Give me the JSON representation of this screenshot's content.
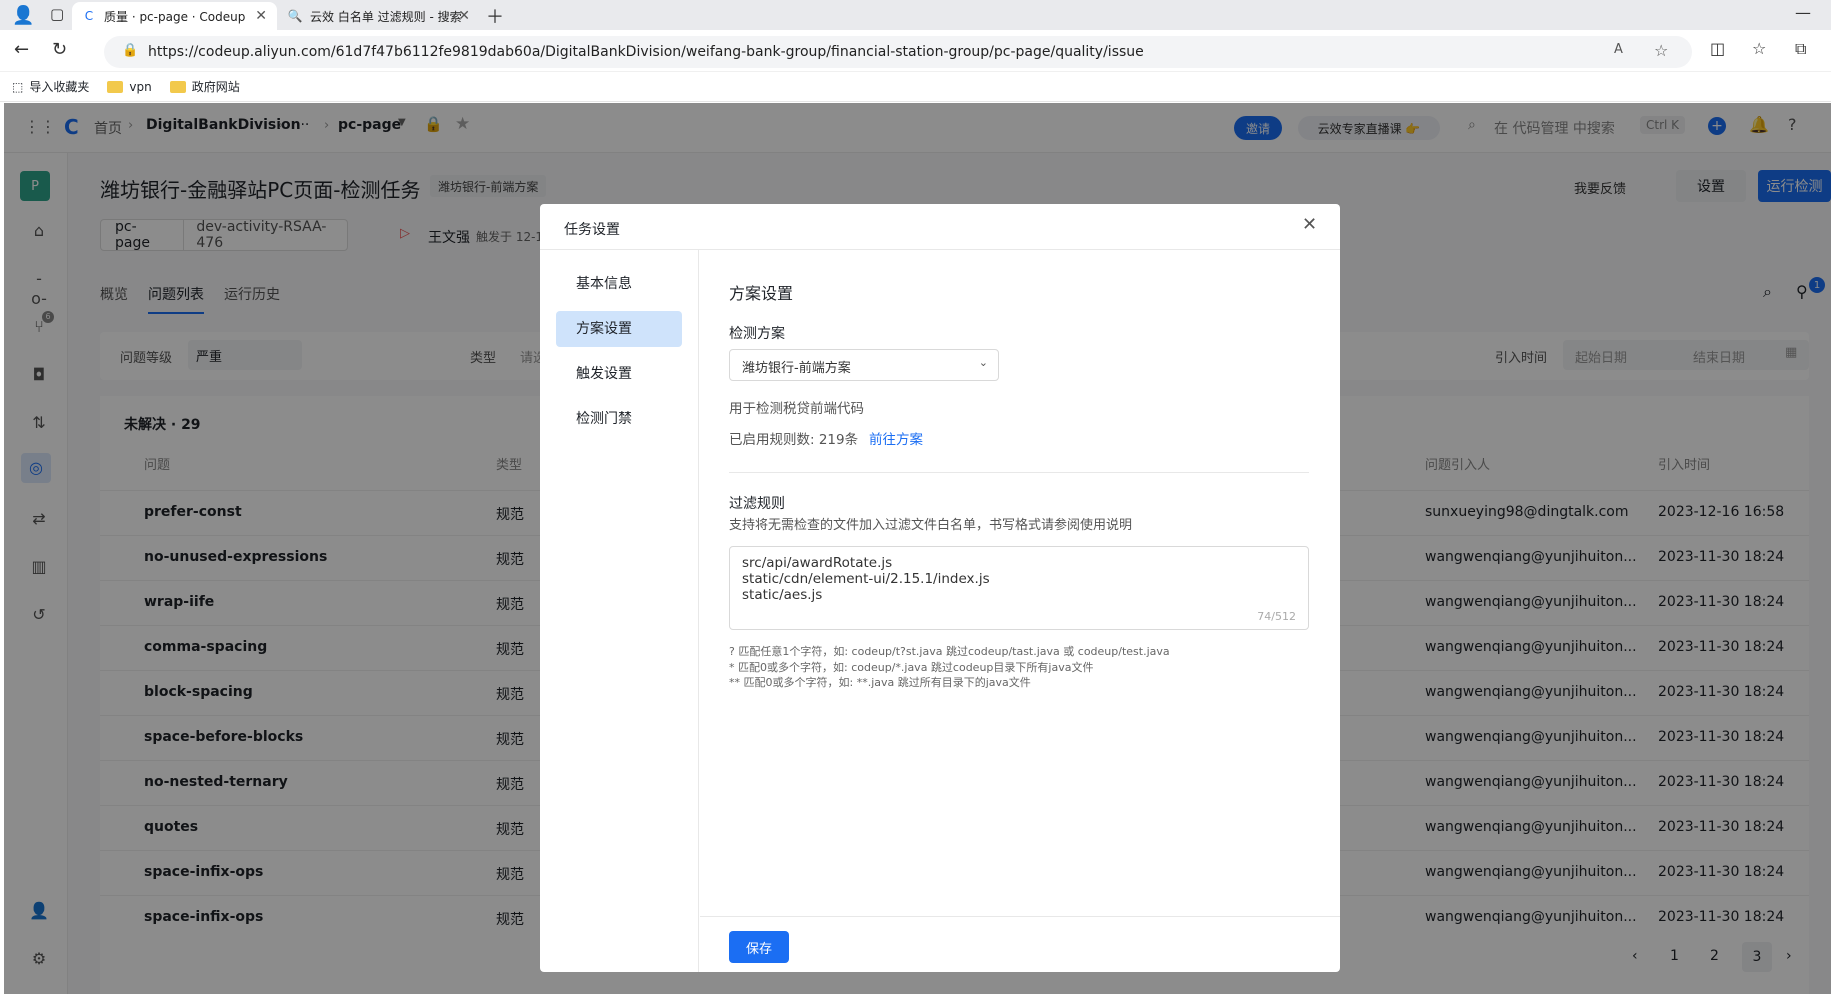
{
  "browser": {
    "tabs": [
      {
        "title": "质量 · pc-page · Codeup",
        "active": true
      },
      {
        "title": "云效 白名单 过滤规则 - 搜索",
        "active": false
      }
    ],
    "url": "https://codeup.aliyun.com/61d7f47b6112fe9819dab60a/DigitalBankDivision/weifang-bank-group/financial-station-group/pc-page/quality/issue",
    "bookmarks": [
      "导入收藏夹",
      "vpn",
      "政府网站"
    ]
  },
  "topnav": {
    "crumbs": [
      "首页",
      "DigitalBankDivision",
      "···",
      "pc-page"
    ],
    "invite": "邀请",
    "promo": "云效专家直播课 👉",
    "search_placeholder": "在 代码管理 中搜索",
    "shortcut": "Ctrl K"
  },
  "sidebar": {
    "avatar": "P",
    "badge": "6"
  },
  "page": {
    "title": "潍坊银行-金融驿站PC页面-检测任务",
    "scheme_tag": "潍坊银行-前端方案",
    "feedback": "我要反馈",
    "settings": "设置",
    "run": "运行检测",
    "repo": "pc-page",
    "branch": "dev-activity-RSAA-476",
    "user": "王文强",
    "trigger": "触发于 12-1",
    "tabs": [
      "概览",
      "问题列表",
      "运行历史"
    ],
    "notif_badge": "1",
    "filter_level_label": "问题等级",
    "filter_level_value": "严重",
    "filter_type_label": "类型",
    "filter_type_placeholder": "请选",
    "intro_time_label": "引入时间",
    "start_date": "起始日期",
    "end_date": "结束日期",
    "section": "未解决 · 29",
    "col_issue": "问题",
    "col_type": "类型",
    "col_person": "问题引入人",
    "col_time": "引入时间",
    "rows": [
      {
        "name": "prefer-const",
        "type": "规范",
        "person": "sunxueying98@dingtalk.com",
        "time": "2023-12-16 16:58"
      },
      {
        "name": "no-unused-expressions",
        "type": "规范",
        "person": "wangwenqiang@yunjihuiton...",
        "time": "2023-11-30 18:24"
      },
      {
        "name": "wrap-iife",
        "type": "规范",
        "person": "wangwenqiang@yunjihuiton...",
        "time": "2023-11-30 18:24"
      },
      {
        "name": "comma-spacing",
        "type": "规范",
        "person": "wangwenqiang@yunjihuiton...",
        "time": "2023-11-30 18:24"
      },
      {
        "name": "block-spacing",
        "type": "规范",
        "person": "wangwenqiang@yunjihuiton...",
        "time": "2023-11-30 18:24"
      },
      {
        "name": "space-before-blocks",
        "type": "规范",
        "person": "wangwenqiang@yunjihuiton...",
        "time": "2023-11-30 18:24"
      },
      {
        "name": "no-nested-ternary",
        "type": "规范",
        "person": "wangwenqiang@yunjihuiton...",
        "time": "2023-11-30 18:24"
      },
      {
        "name": "quotes",
        "type": "规范",
        "person": "wangwenqiang@yunjihuiton...",
        "time": "2023-11-30 18:24"
      },
      {
        "name": "space-infix-ops",
        "type": "规范",
        "person": "wangwenqiang@yunjihuiton...",
        "time": "2023-11-30 18:24"
      },
      {
        "name": "space-infix-ops",
        "type": "规范",
        "person": "wangwenqiang@yunjihuiton...",
        "time": "2023-11-30 18:24"
      }
    ],
    "pages": [
      "1",
      "2",
      "3"
    ]
  },
  "modal": {
    "title": "任务设置",
    "nav": [
      "基本信息",
      "方案设置",
      "触发设置",
      "检测门禁"
    ],
    "section_title": "方案设置",
    "scheme_label": "检测方案",
    "scheme_value": "潍坊银行-前端方案",
    "scheme_desc": "用于检测税贷前端代码",
    "rules_count": "已启用规则数: 219条",
    "goto_link": "前往方案",
    "filter_title": "过滤规则",
    "filter_desc": "支持将无需检查的文件加入过滤文件白名单，书写格式请参阅使用说明",
    "filter_lines": [
      "src/api/awardRotate.js",
      "static/cdn/element-ui/2.15.1/index.js",
      "static/aes.js"
    ],
    "char_count": "74/512",
    "help": [
      "? 匹配任意1个字符，如: codeup/t?st.java 跳过codeup/tast.java 或 codeup/test.java",
      "* 匹配0或多个字符，如: codeup/*.java 跳过codeup目录下所有java文件",
      "** 匹配0或多个字符，如: **.java 跳过所有目录下的java文件"
    ],
    "save": "保存"
  }
}
